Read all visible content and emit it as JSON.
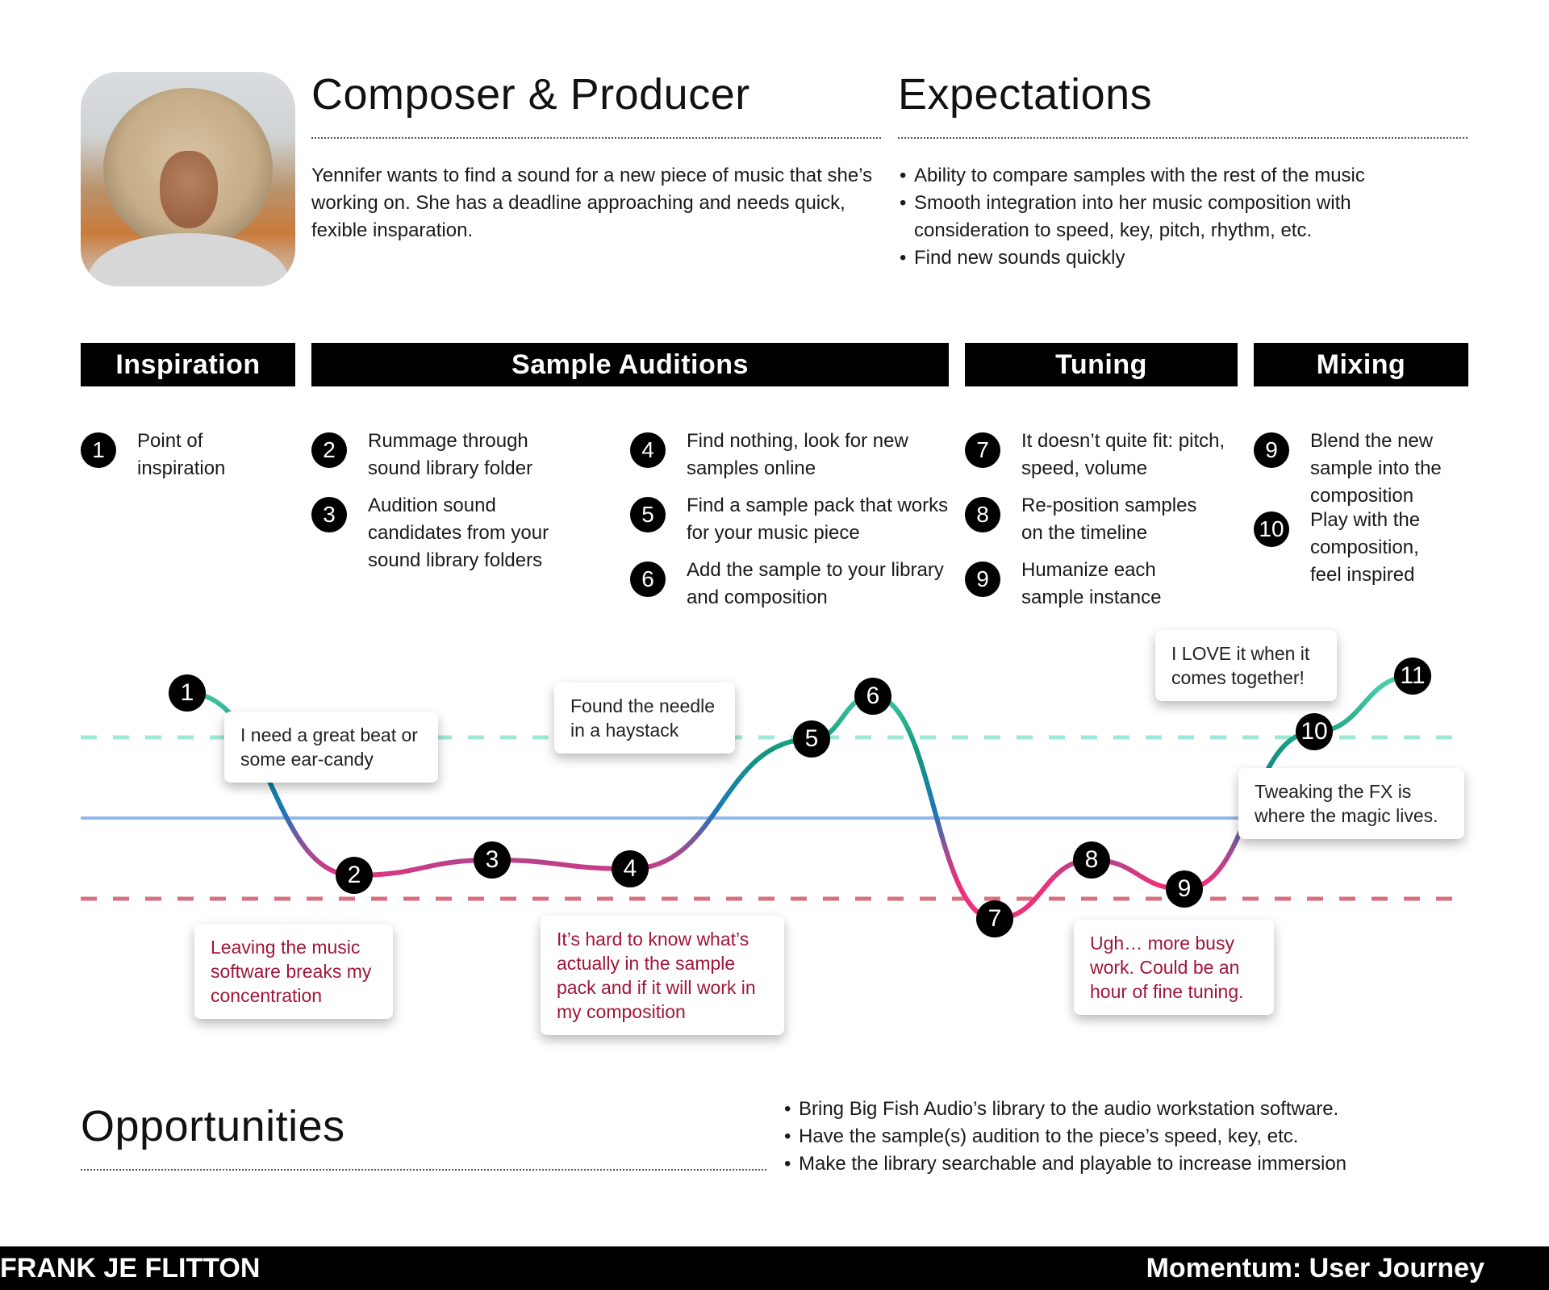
{
  "persona": {
    "avatar_alt": "persona-photo",
    "title": "Composer & Producer",
    "description": "Yennifer wants to find a sound for a new piece of music that she’s working on. She has a deadline approaching and needs quick, fexible insparation."
  },
  "expectations": {
    "title": "Expectations",
    "items": [
      "Ability to compare samples with the rest of the music",
      "Smooth integration into her music composition with consideration to speed, key, pitch, rhythm, etc.",
      "Find new sounds quickly"
    ]
  },
  "stages": [
    {
      "label": "Inspiration"
    },
    {
      "label": "Sample Auditions"
    },
    {
      "label": "Tuning"
    },
    {
      "label": "Mixing"
    }
  ],
  "steps": {
    "inspiration": [
      {
        "num": "1",
        "text": "Point of inspiration"
      }
    ],
    "auditions_a": [
      {
        "num": "2",
        "text": "Rummage through sound library folder"
      },
      {
        "num": "3",
        "text": "Audition sound candidates from your sound library folders"
      }
    ],
    "auditions_b": [
      {
        "num": "4",
        "text": "Find nothing, look for new samples online"
      },
      {
        "num": "5",
        "text": "Find a sample pack that works for your music piece"
      },
      {
        "num": "6",
        "text": "Add the sample to your library and composition"
      }
    ],
    "tuning": [
      {
        "num": "7",
        "text": "It doesn’t quite fit: pitch, speed, volume"
      },
      {
        "num": "8",
        "text": "Re-position samples on the timeline"
      },
      {
        "num": "9",
        "text": "Humanize each sample instance"
      }
    ],
    "mixing": [
      {
        "num": "9",
        "text": "Blend the new sample into the composition"
      },
      {
        "num": "10",
        "text": "Play with the composition, feel inspired"
      }
    ]
  },
  "chart_data": {
    "type": "line",
    "title": "Momentum",
    "reference_lines": [
      {
        "name": "positive-threshold",
        "style": "dashed",
        "color": "#9fe7d6",
        "level": 1
      },
      {
        "name": "neutral-baseline",
        "style": "solid",
        "color": "#94b8e6",
        "level": 0
      },
      {
        "name": "negative-threshold",
        "style": "dashed",
        "color": "#d9707f",
        "level": -1
      }
    ],
    "colors": {
      "positive": "#4fd1b0",
      "mid": "#1a75b8",
      "negative": "#ee2f7a"
    },
    "points": [
      {
        "label": "1",
        "step": 1,
        "value": 1.55
      },
      {
        "label": "2",
        "step": 2,
        "value": -0.71
      },
      {
        "label": "3",
        "step": 3,
        "value": -0.52
      },
      {
        "label": "4",
        "step": 4,
        "value": -0.63
      },
      {
        "label": "5",
        "step": 5,
        "value": 0.98
      },
      {
        "label": "6",
        "step": 6,
        "value": 1.51
      },
      {
        "label": "7",
        "step": 7,
        "value": -1.25
      },
      {
        "label": "8",
        "step": 8,
        "value": -0.52
      },
      {
        "label": "9",
        "step": 9,
        "value": -0.88
      },
      {
        "label": "10",
        "step": 10,
        "value": 1.07
      },
      {
        "label": "11",
        "step": 11,
        "value": 1.76
      }
    ],
    "annotations": [
      {
        "text": "I need a great beat or some ear-candy",
        "sentiment": "positive",
        "near": "1"
      },
      {
        "text": "Found the needle in a haystack",
        "sentiment": "positive",
        "near": "5"
      },
      {
        "text": "I LOVE it when it comes together!",
        "sentiment": "positive",
        "near": "10"
      },
      {
        "text": "Tweaking the FX is where the magic lives.",
        "sentiment": "positive",
        "near": "10"
      },
      {
        "text": "Leaving the music software breaks my concentration",
        "sentiment": "negative",
        "near": "2"
      },
      {
        "text": "It’s hard to know what’s actually in the sample pack and if it will work in my composition",
        "sentiment": "negative",
        "near": "4"
      },
      {
        "text": "Ugh… more busy work. Could be an hour of fine tuning.",
        "sentiment": "negative",
        "near": "8"
      }
    ]
  },
  "opportunities": {
    "title": "Opportunities",
    "items": [
      "Bring Big Fish Audio’s library to the audio workstation software.",
      "Have the sample(s) audition to the piece’s speed, key, etc.",
      "Make the library searchable and playable to increase immersion"
    ]
  },
  "footer": {
    "author": "FRANK JE FLITTON",
    "project": "Momentum: User Journey"
  }
}
